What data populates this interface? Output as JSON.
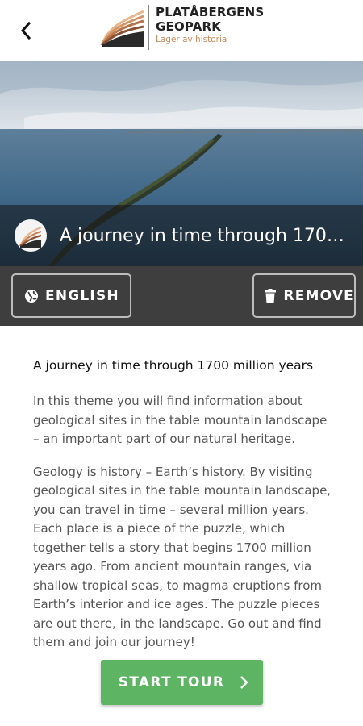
{
  "header": {
    "back_icon": "chevron-left-icon",
    "logo_line1": "PLATÅBERGENS",
    "logo_line2": "GEOPARK",
    "logo_tagline": "Lager av historia"
  },
  "hero": {
    "title": "A journey in time through 170…",
    "theme_icon": "geopark-logo-icon"
  },
  "actions": {
    "language_label": "ENGLISH",
    "language_icon": "globe-icon",
    "remove_label": "REMOVE",
    "remove_icon": "trash-icon"
  },
  "content": {
    "heading": "A journey in time through 1700 million years",
    "paragraph1": "In this theme you will find information about geological sites in the table mountain landscape – an important part of our natural heritage.",
    "paragraph2": "Geology is history – Earth’s history. By visiting geological sites in the table mountain landscape, you can travel in time – several million years. Each place is a piece of the puzzle, which together tells a story that begins 1700 million years ago. From ancient mountain ranges, via shallow tropical seas, to magma eruptions from Earth’s interior and ice ages. The puzzle pieces are out there, in the landscape. Go out and find them and join our journey!"
  },
  "start_tour": {
    "label": "START TOUR",
    "icon": "chevron-right-icon",
    "color": "#5db563"
  },
  "colors": {
    "action_bar": "#3e3e3e",
    "logo_accent": "#c98a5d"
  }
}
